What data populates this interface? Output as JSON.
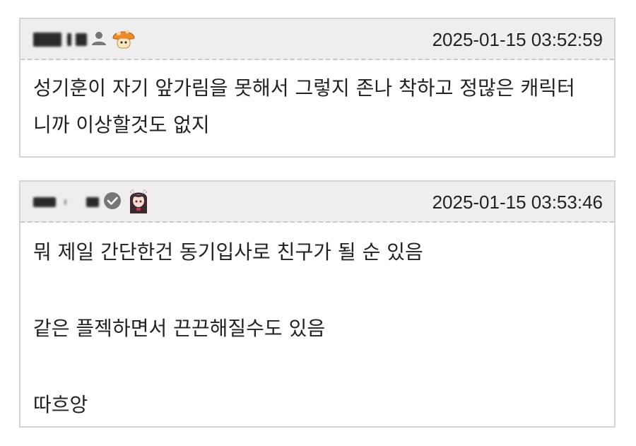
{
  "comments": [
    {
      "timestamp": "2025-01-15 03:52:59",
      "author_icons": [
        "user-icon",
        "mushroom-avatar-icon"
      ],
      "body": "성기훈이 자기 앞가림을 못해서 그렇지 존나 착하고 정많은 캐릭터\n니까 이상할것도 없지"
    },
    {
      "timestamp": "2025-01-15 03:53:46",
      "author_icons": [
        "verified-check-icon",
        "anime-girl-avatar-icon"
      ],
      "body": "뭐 제일 간단한건 동기입사로 친구가 될 순 있음\n\n같은 플젝하면서 끈끈해질수도 있음\n\n따흐앙"
    }
  ],
  "colors": {
    "header_bg": "#eeeeee",
    "border": "#d4d4d4",
    "text": "#222222"
  }
}
